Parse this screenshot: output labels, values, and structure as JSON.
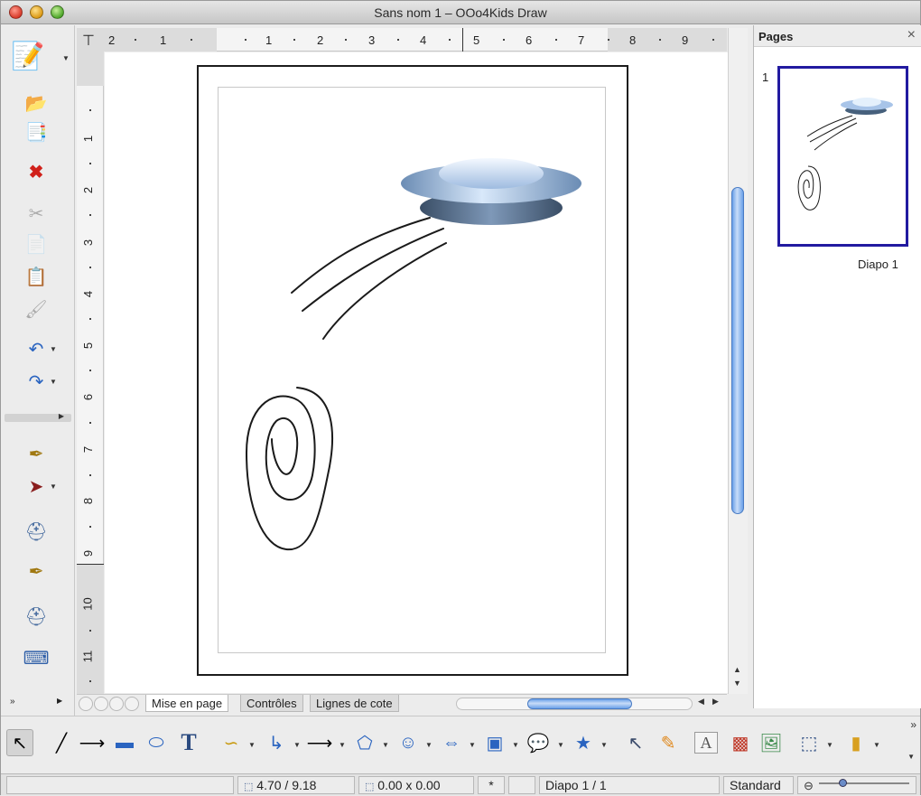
{
  "window": {
    "title": "Sans nom 1 – OOo4Kids Draw"
  },
  "left_toolbar": {
    "icons": [
      "new-document-icon",
      "open-folder-icon",
      "edit-document-icon",
      "export-pdf-icon",
      "cut-icon",
      "copy-icon",
      "paste-icon",
      "clone-format-icon",
      "undo-icon",
      "redo-icon",
      "pen-icon",
      "arrow-shape-icon",
      "paint-bucket-icon",
      "pen-tool-icon",
      "fill-tool-icon",
      "eraser-icon"
    ]
  },
  "rulers": {
    "horizontal": [
      "2",
      "1",
      "1",
      "2",
      "3",
      "4",
      "5",
      "6",
      "7",
      "8",
      "9"
    ],
    "vertical": [
      "1",
      "2",
      "3",
      "4",
      "5",
      "6",
      "7",
      "8",
      "9",
      "10",
      "11"
    ]
  },
  "pages_panel": {
    "title": "Pages",
    "close": "×",
    "thumbnails": [
      {
        "number": "1",
        "label": "Diapo 1"
      }
    ]
  },
  "tabs": [
    {
      "label": "Mise en page",
      "active": true
    },
    {
      "label": "Contrôles",
      "active": false
    },
    {
      "label": "Lignes de cote",
      "active": false
    }
  ],
  "drawing_toolbar": {
    "tools": [
      "select-icon",
      "line-icon",
      "arrow-line-icon",
      "rectangle-icon",
      "ellipse-icon",
      "text-icon",
      "curve-icon",
      "connector-icon",
      "lines-arrows-icon",
      "basic-shapes-icon",
      "symbol-shapes-icon",
      "block-arrows-icon",
      "flowchart-icon",
      "callout-icon",
      "stars-icon",
      "points-icon",
      "glue-points-icon",
      "fontwork-icon",
      "from-file-icon",
      "gallery-icon",
      "rotate-icon",
      "align-icon"
    ],
    "more": "»"
  },
  "statusbar": {
    "position": "4.70 / 9.18",
    "size": "0.00 x 0.00",
    "modified": "*",
    "slide": "Diapo 1 / 1",
    "layout": "Standard",
    "zoom_minus": "⊖"
  },
  "colors": {
    "selection_border": "#221aa0",
    "scroll_thumb": "#6aa0e8",
    "ufo_light": "#d8e8fa",
    "ufo_dark": "#46607c"
  }
}
